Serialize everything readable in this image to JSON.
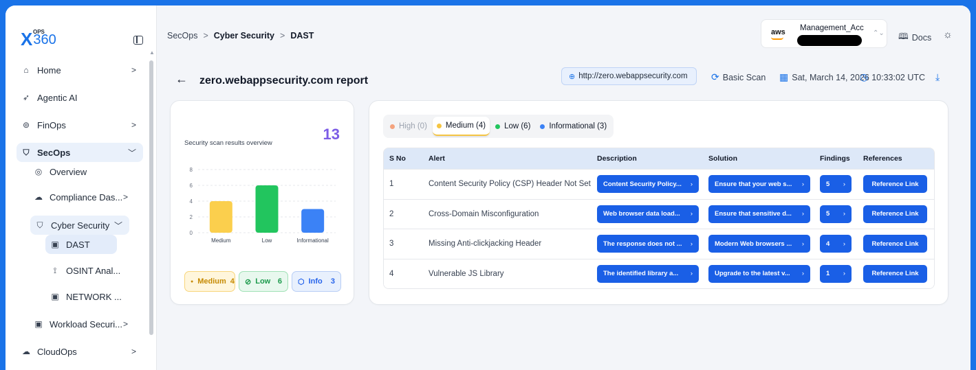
{
  "logo": {
    "ops": "OPS",
    "x": "X",
    "num": "360"
  },
  "sidebar": {
    "items": [
      {
        "label": "Home",
        "icon": "home-icon",
        "chevron": ">"
      },
      {
        "label": "Agentic AI",
        "icon": "rocket-icon",
        "chevron": ""
      },
      {
        "label": "FinOps",
        "icon": "dollar-icon",
        "chevron": ">"
      },
      {
        "label": "SecOps",
        "icon": "shield-icon",
        "chevron": "v"
      },
      {
        "label": "Overview",
        "icon": "overview-icon",
        "chevron": ""
      },
      {
        "label": "Compliance Das...",
        "icon": "cloud-icon",
        "chevron": ">"
      },
      {
        "label": "Cyber Security",
        "icon": "shield-icon",
        "chevron": "v"
      },
      {
        "label": "DAST",
        "icon": "scan-icon",
        "chevron": ""
      },
      {
        "label": "OSINT Anal...",
        "icon": "osint-icon",
        "chevron": ""
      },
      {
        "label": "NETWORK ...",
        "icon": "scan-icon",
        "chevron": ""
      },
      {
        "label": "Workload Securi...",
        "icon": "scan-icon",
        "chevron": ">"
      },
      {
        "label": "CloudOps",
        "icon": "cloud-icon",
        "chevron": ">"
      }
    ]
  },
  "breadcrumb": {
    "items": [
      "SecOps",
      "Cyber Security",
      "DAST"
    ],
    "sep": ">"
  },
  "account": {
    "provider": "aws",
    "name": "Management_Acc"
  },
  "header": {
    "docs_label": "Docs"
  },
  "report": {
    "title": "zero.webappsecurity.com report",
    "url": "http://zero.webappsecurity.com",
    "scan_type": "Basic Scan",
    "date": "Sat, March 14, 2026",
    "time": "10:33:02 UTC"
  },
  "overview": {
    "label": "Security scan results overview",
    "total": "13",
    "badges": [
      {
        "label": "Medium",
        "count": "4"
      },
      {
        "label": "Low",
        "count": "6"
      },
      {
        "label": "Info",
        "count": "3"
      }
    ]
  },
  "chart_data": {
    "type": "bar",
    "categories": [
      "Medium",
      "Low",
      "Informational"
    ],
    "values": [
      4,
      6,
      3
    ],
    "colors": [
      "#fbcf4d",
      "#22c55e",
      "#3b82f6"
    ],
    "ylim": [
      0,
      8
    ],
    "yticks": [
      0,
      2,
      4,
      6,
      8
    ],
    "grid": true
  },
  "filters": [
    {
      "label": "High (0)",
      "color": "#f4a37e",
      "disabled": true
    },
    {
      "label": "Medium (4)",
      "color": "#f5c542",
      "selected": true
    },
    {
      "label": "Low (6)",
      "color": "#22c55e"
    },
    {
      "label": "Informational (3)",
      "color": "#3b82f6"
    }
  ],
  "table": {
    "headers": [
      "S No",
      "Alert",
      "Description",
      "Solution",
      "Findings",
      "References"
    ],
    "rows": [
      {
        "sno": "1",
        "alert": "Content Security Policy (CSP) Header Not Set",
        "desc": "Content Security Policy...",
        "sol": "Ensure that your web s...",
        "findings": "5",
        "ref": "Reference Link"
      },
      {
        "sno": "2",
        "alert": "Cross-Domain Misconfiguration",
        "desc": "Web browser data load...",
        "sol": "Ensure that sensitive d...",
        "findings": "5",
        "ref": "Reference Link"
      },
      {
        "sno": "3",
        "alert": "Missing Anti-clickjacking Header",
        "desc": "The response does not ...",
        "sol": "Modern Web browsers ...",
        "findings": "4",
        "ref": "Reference Link"
      },
      {
        "sno": "4",
        "alert": "Vulnerable JS Library",
        "desc": "The identified library a...",
        "sol": "Upgrade to the latest v...",
        "findings": "1",
        "ref": "Reference Link"
      }
    ]
  }
}
